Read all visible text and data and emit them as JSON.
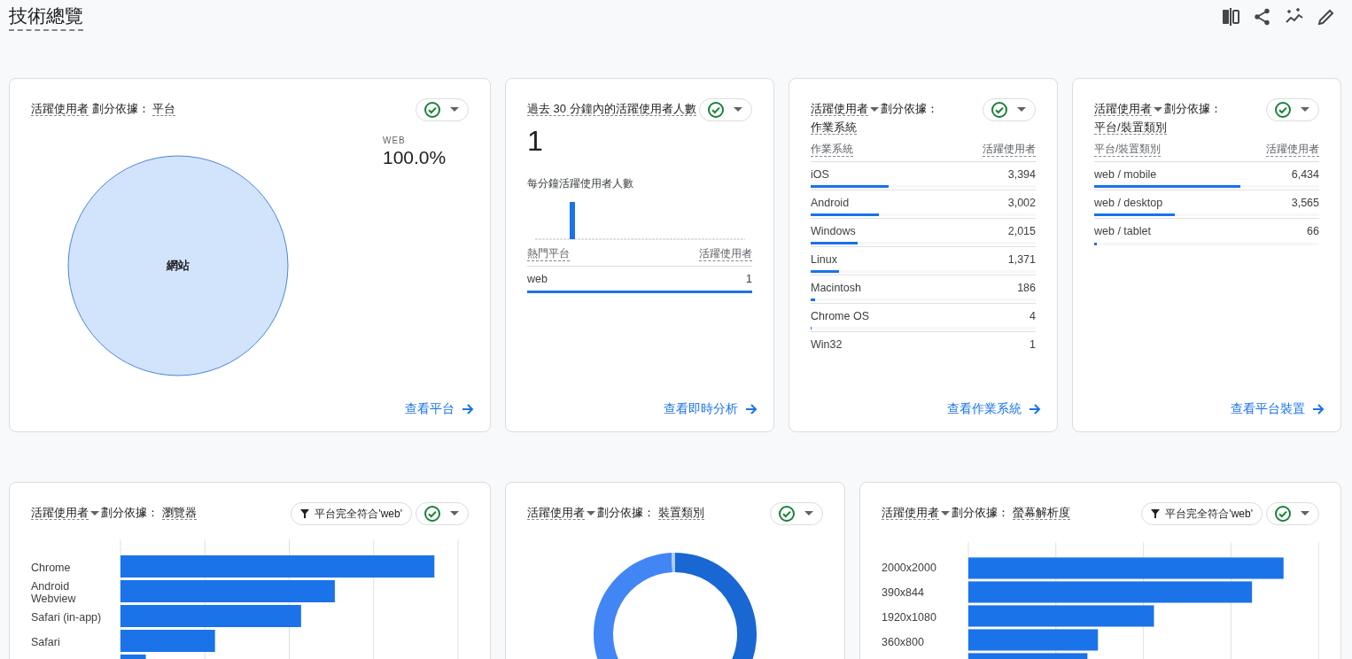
{
  "page": {
    "title": "技術總覽"
  },
  "row_1": [
    {
      "kind": "pie",
      "title": {
        "metric": "活躍使用者",
        "metric_caret": false,
        "by": "劃分依據：",
        "dimension": "平台"
      },
      "slice_label": "網站",
      "legend": {
        "label": "WEB",
        "value": "100.0%"
      },
      "link": "查看平台"
    },
    {
      "kind": "realtime",
      "title": {
        "metric": "過去 30 分鐘內的活躍使用者人數",
        "metric_caret": false
      },
      "value": "1",
      "subtitle": "每分鐘活躍使用者人數",
      "columns": [
        "熱門平台",
        "活躍使用者"
      ],
      "rows": [
        {
          "name": "web",
          "value": "1",
          "level": 1
        }
      ],
      "link": "查看即時分析"
    },
    {
      "kind": "table",
      "title": {
        "metric": "活躍使用者",
        "metric_caret": true,
        "by": "劃分依據：",
        "dimension": "作業系統"
      },
      "columns": [
        "作業系統",
        "活躍使用者"
      ],
      "rows": [
        {
          "name": "iOS",
          "value": "3,394",
          "level": 0.345
        },
        {
          "name": "Android",
          "value": "3,002",
          "level": 0.305
        },
        {
          "name": "Windows",
          "value": "2,015",
          "level": 0.21
        },
        {
          "name": "Linux",
          "value": "1,371",
          "level": 0.125
        },
        {
          "name": "Macintosh",
          "value": "186",
          "level": 0.02
        },
        {
          "name": "Chrome OS",
          "value": "4",
          "level": 0.005
        },
        {
          "name": "Win32",
          "value": "1"
        }
      ],
      "link": "查看作業系統"
    },
    {
      "kind": "table",
      "title": {
        "metric": "活躍使用者",
        "metric_caret": true,
        "by": "劃分依據：",
        "dimension": "平台/裝置類別"
      },
      "columns": [
        "平台/裝置類別",
        "活躍使用者"
      ],
      "rows": [
        {
          "name": "web / mobile",
          "value": "6,434",
          "level": 0.65
        },
        {
          "name": "web / desktop",
          "value": "3,565",
          "level": 0.36
        },
        {
          "name": "web / tablet",
          "value": "66",
          "level": 0.01
        }
      ],
      "link": "查看平台裝置"
    }
  ],
  "row_2": [
    {
      "kind": "bar",
      "title": {
        "metric": "活躍使用者",
        "metric_caret": true,
        "by": "劃分依據：",
        "dimension": "瀏覽器"
      },
      "filter": "平台完全符合'web'",
      "categories": [
        "Chrome",
        "Android Webview",
        "Safari (in-app)",
        "Safari"
      ]
    },
    {
      "kind": "donut",
      "title": {
        "metric": "活躍使用者",
        "metric_caret": true,
        "by": "劃分依據：",
        "dimension": "裝置類別"
      }
    },
    {
      "kind": "bar",
      "title": {
        "metric": "活躍使用者",
        "metric_caret": true,
        "by": "劃分依據：",
        "dimension": "螢幕解析度"
      },
      "filter": "平台完全符合'web'",
      "categories": [
        "2000x2000",
        "390x844",
        "1920x1080",
        "360x800"
      ]
    }
  ]
}
